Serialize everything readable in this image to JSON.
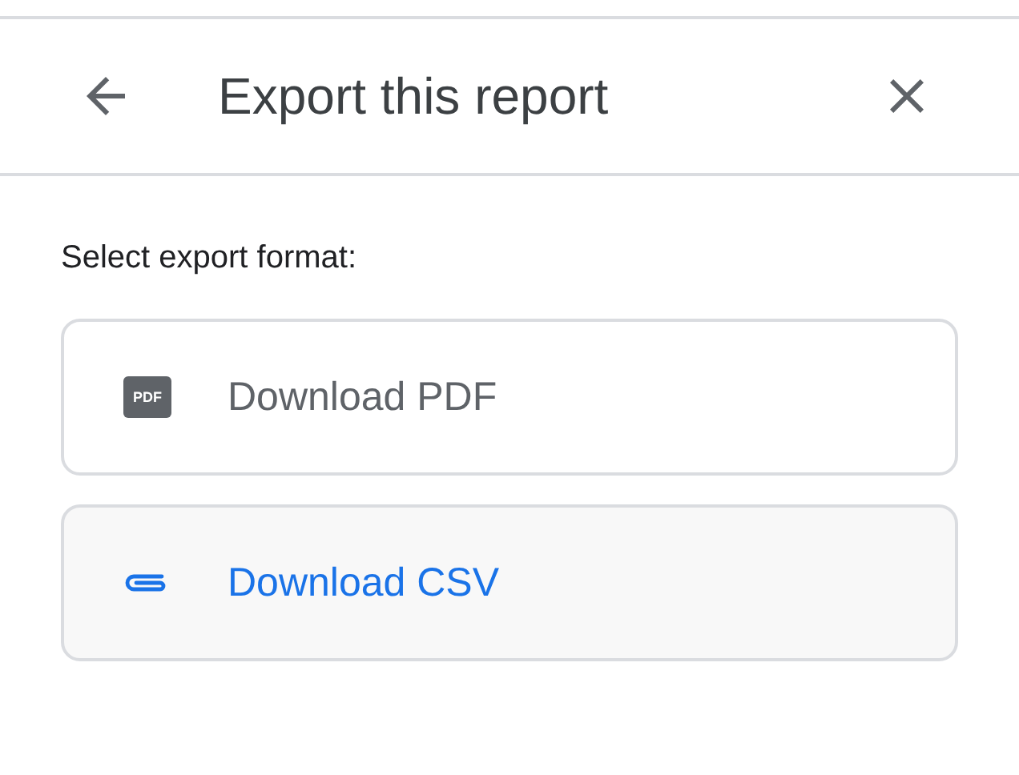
{
  "header": {
    "title": "Export this report"
  },
  "prompt": "Select export format:",
  "options": [
    {
      "kind": "pdf",
      "icon_text": "PDF",
      "label": "Download PDF",
      "selected": false
    },
    {
      "kind": "attachment",
      "label": "Download CSV",
      "selected": true
    }
  ]
}
